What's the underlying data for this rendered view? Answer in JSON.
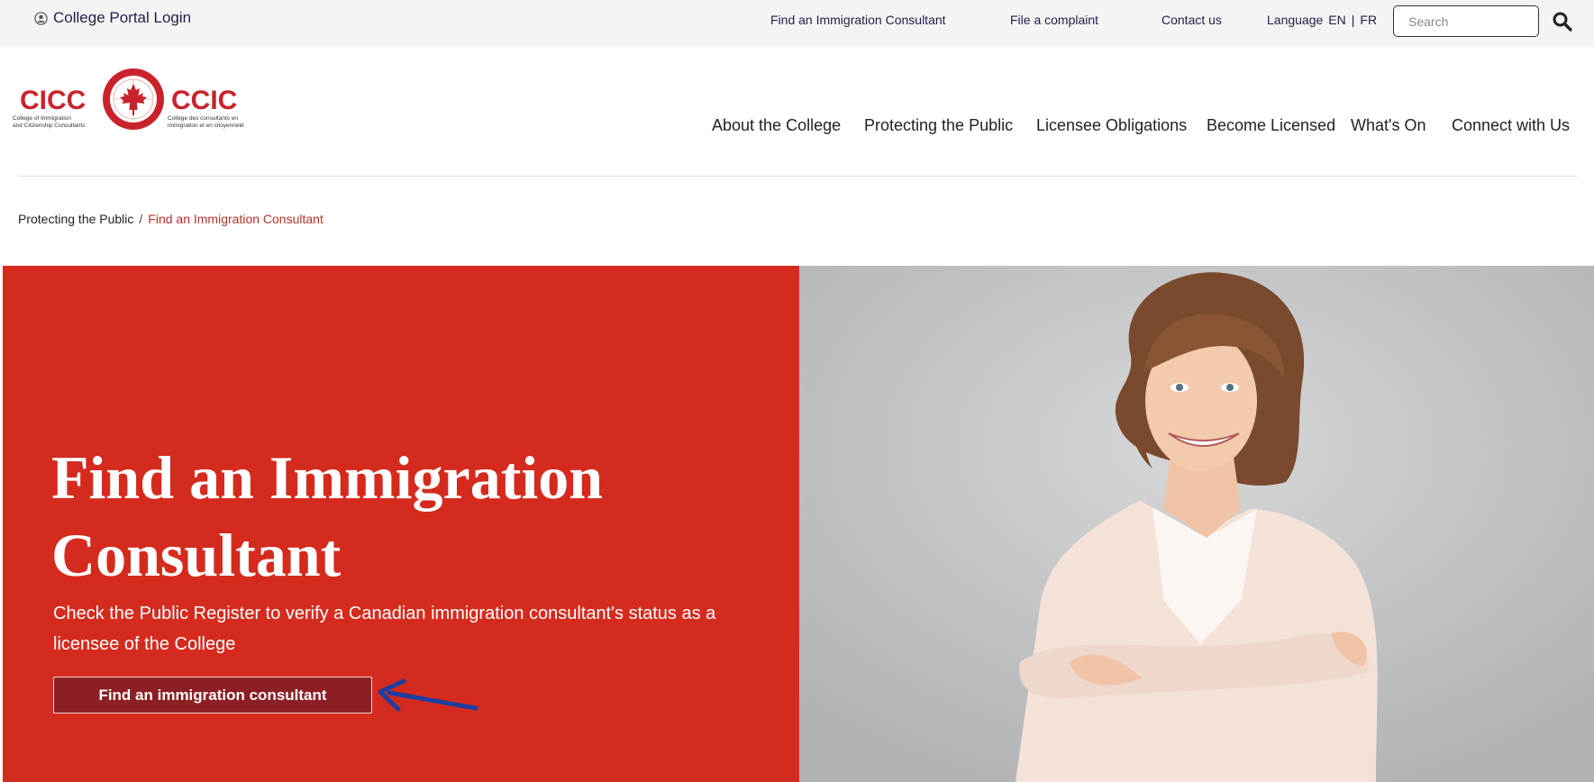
{
  "topbar": {
    "portal_login": "College Portal Login",
    "links": [
      "Find an Immigration Consultant",
      "File a complaint",
      "Contact us"
    ],
    "language_label": "Language",
    "language_en": "EN",
    "language_sep": "|",
    "language_fr": "FR",
    "search_placeholder": "Search"
  },
  "logo": {
    "left_acronym": "CICC",
    "right_acronym": "CCIC",
    "left_line1": "College of Immigration",
    "left_line2": "and Citizenship Consultants",
    "right_line1": "Collège des consultants en",
    "right_line2": "immigration et en citoyenneté"
  },
  "nav": [
    "About the College",
    "Protecting the Public",
    "Licensee Obligations",
    "Become Licensed",
    "What's On",
    "Connect with Us"
  ],
  "breadcrumb": {
    "parent": "Protecting the Public",
    "separator": "/",
    "current": "Find an Immigration Consultant"
  },
  "hero": {
    "title_line1": "Find an Immigration",
    "title_line2": "Consultant",
    "subtitle_line1": "Check the Public Register to verify a Canadian immigration consultant's status as a",
    "subtitle_line2": "licensee of the College",
    "button_label": "Find an immigration consultant"
  },
  "colors": {
    "brand_red": "#d52b1e",
    "button_dark_red": "#8c1f23",
    "breadcrumb_active": "#b3342a",
    "annotation_arrow": "#1f3fa0"
  },
  "icons": [
    "user-circle-icon",
    "search-icon",
    "maple-leaf-icon",
    "arrow-annotation-icon"
  ]
}
